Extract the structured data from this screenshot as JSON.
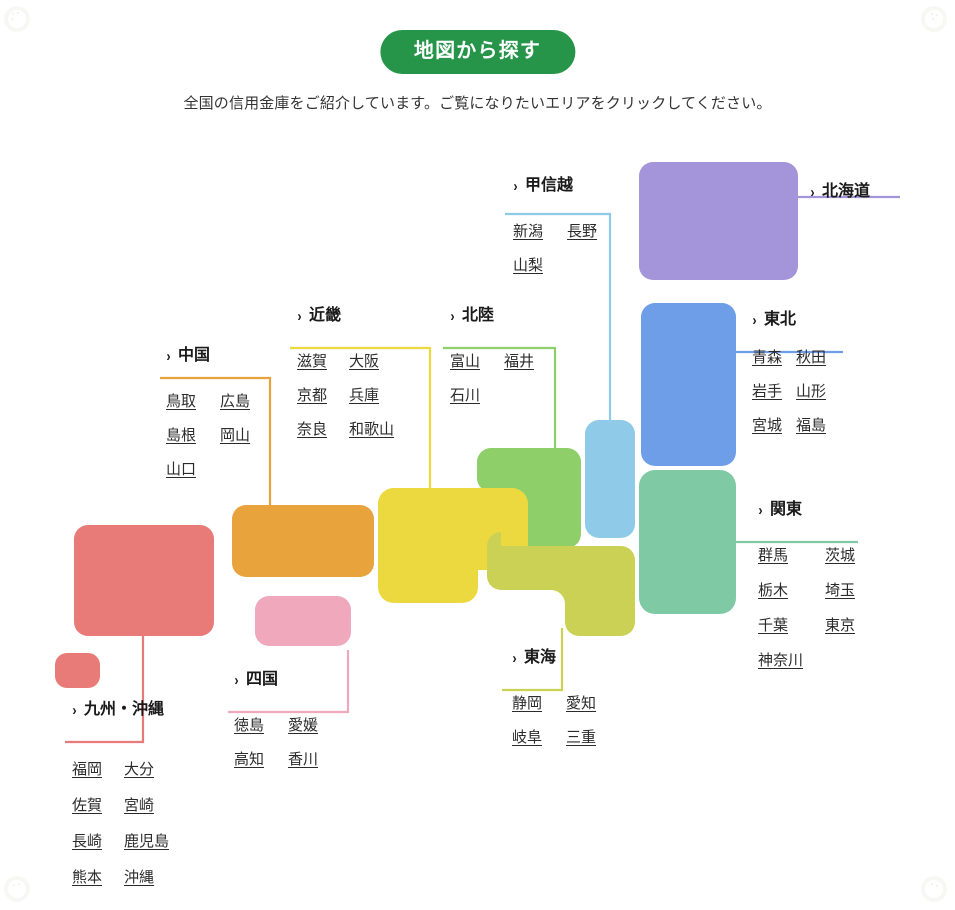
{
  "header": {
    "title": "地図から探す",
    "subtitle": "全国の信用金庫をご紹介しています。ご覧になりたいエリアをクリックしてください。",
    "title_bg": "#26954a",
    "title_color": "#ffffff"
  },
  "chevron": "›",
  "regions": [
    {
      "key": "hokkaido",
      "label": "北海道",
      "color": "#a495da",
      "prefectures": []
    },
    {
      "key": "tohoku",
      "label": "東北",
      "color": "#6e9ee8",
      "prefectures": [
        "青森",
        "秋田",
        "岩手",
        "山形",
        "宮城",
        "福島"
      ]
    },
    {
      "key": "koshinetsu",
      "label": "甲信越",
      "color": "#8fcbe8",
      "prefectures": [
        "新潟",
        "長野",
        "山梨"
      ]
    },
    {
      "key": "kanto",
      "label": "関東",
      "color": "#7fc9a5",
      "prefectures": [
        "群馬",
        "茨城",
        "栃木",
        "埼玉",
        "千葉",
        "東京",
        "神奈川"
      ]
    },
    {
      "key": "hokuriku",
      "label": "北陸",
      "color": "#8ecf69",
      "prefectures": [
        "富山",
        "福井",
        "石川"
      ]
    },
    {
      "key": "tokai",
      "label": "東海",
      "color": "#cbd154",
      "prefectures": [
        "静岡",
        "愛知",
        "岐阜",
        "三重"
      ]
    },
    {
      "key": "kinki",
      "label": "近畿",
      "color": "#ecd940",
      "prefectures": [
        "滋賀",
        "大阪",
        "京都",
        "兵庫",
        "奈良",
        "和歌山"
      ]
    },
    {
      "key": "chugoku",
      "label": "中国",
      "color": "#e8a33d",
      "prefectures": [
        "鳥取",
        "広島",
        "島根",
        "岡山",
        "山口"
      ]
    },
    {
      "key": "shikoku",
      "label": "四国",
      "color": "#f0a8bc",
      "prefectures": [
        "徳島",
        "愛媛",
        "高知",
        "香川"
      ]
    },
    {
      "key": "kyushu",
      "label": "九州・沖縄",
      "color": "#e87b77",
      "prefectures": [
        "福岡",
        "大分",
        "佐賀",
        "宮崎",
        "長崎",
        "鹿児島",
        "熊本",
        "沖縄"
      ]
    }
  ]
}
